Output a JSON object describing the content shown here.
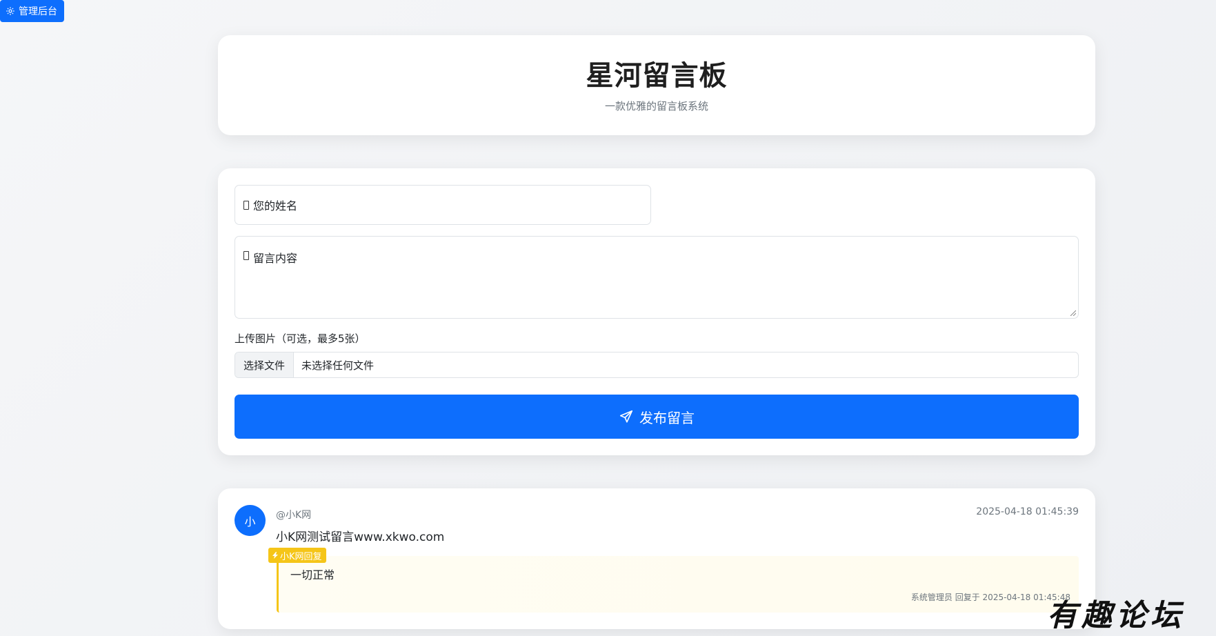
{
  "admin": {
    "label": "管理后台",
    "icon": "gear-icon"
  },
  "header": {
    "title": "星河留言板",
    "subtitle": "一款优雅的留言板系统"
  },
  "form": {
    "name_placeholder": "您的姓名",
    "content_placeholder": "留言内容",
    "upload_label": "上传图片（可选，最多5张）",
    "file_button": "选择文件",
    "file_status": "未选择任何文件",
    "submit_label": "发布留言",
    "submit_icon": "send-icon"
  },
  "messages": [
    {
      "avatar": "小",
      "author": "@小K网",
      "time": "2025-04-18 01:45:39",
      "text": "小K网测试留言www.xkwo.com",
      "reply": {
        "badge": "小K网回复",
        "text": "一切正常",
        "meta": "系统管理员 回复于 2025-04-18 01:45:48"
      }
    }
  ],
  "watermark": "有趣论坛",
  "colors": {
    "primary": "#0d6efd",
    "reply_accent": "#f5c518"
  }
}
